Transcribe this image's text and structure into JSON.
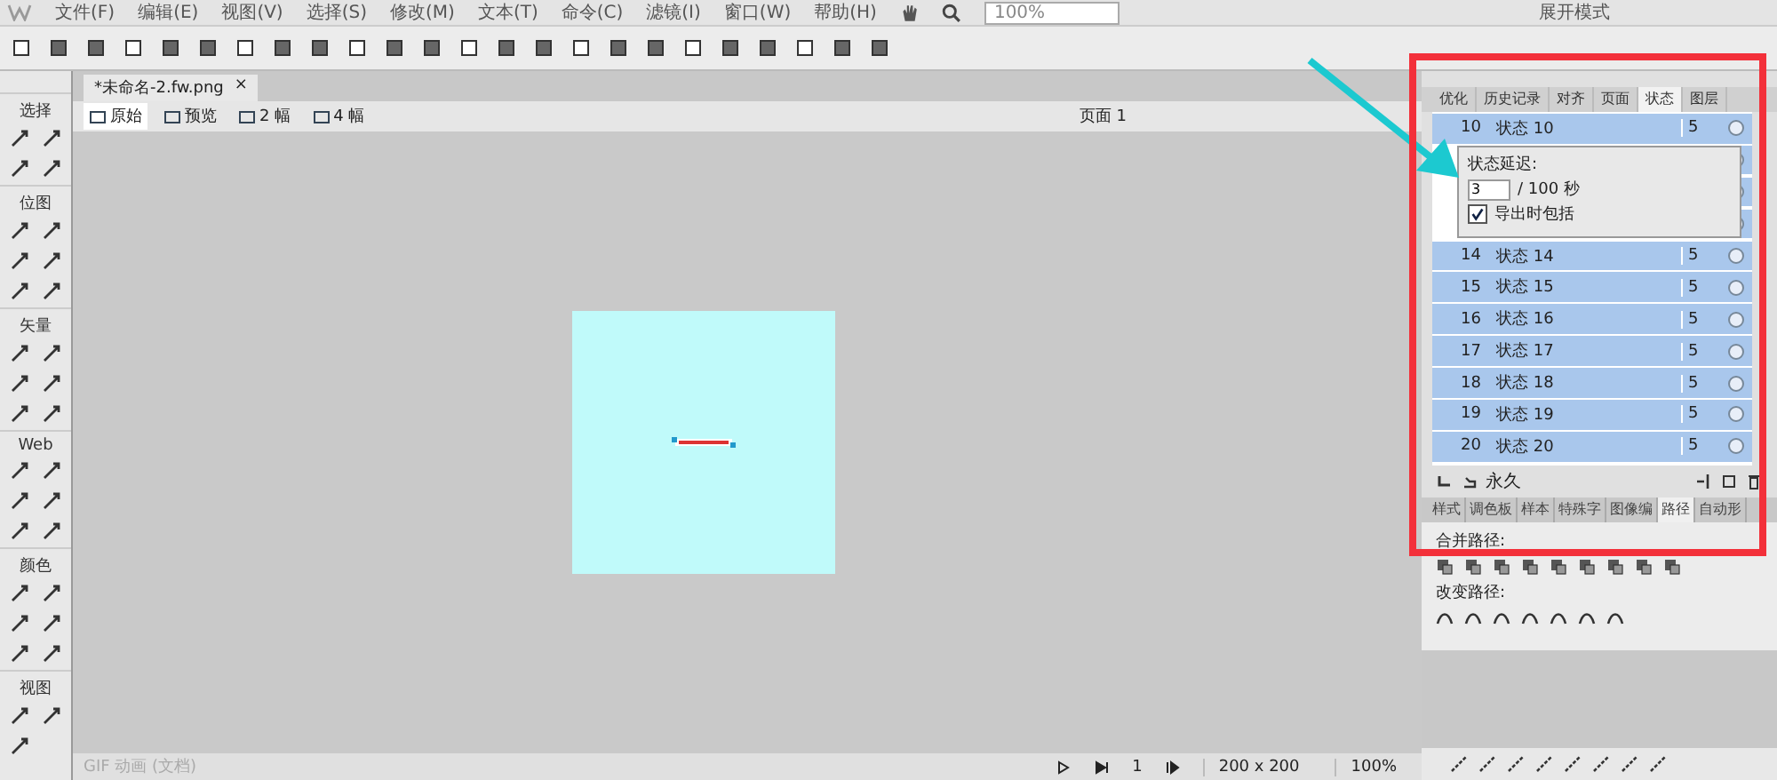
{
  "menu_bar": {
    "items": [
      "文件(F)",
      "编辑(E)",
      "视图(V)",
      "选择(S)",
      "修改(M)",
      "文本(T)",
      "命令(C)",
      "滤镜(I)",
      "窗口(W)",
      "帮助(H)"
    ],
    "zoom": "100%",
    "workspace": "展开模式"
  },
  "tools_panel": {
    "sections": [
      "选择",
      "位图",
      "矢量",
      "Web",
      "颜色",
      "视图"
    ]
  },
  "document_tab": {
    "title": "*未命名-2.fw.png",
    "close": "×"
  },
  "view_modes": [
    {
      "label": "原始",
      "selected": true
    },
    {
      "label": "预览",
      "selected": false
    },
    {
      "label": "2 幅",
      "selected": false
    },
    {
      "label": "4 幅",
      "selected": false
    }
  ],
  "page_selector": "页面 1",
  "status_bar": {
    "format": "GIF 动画 (文档)",
    "frame": "1",
    "size": "200 x 200",
    "zoom": "100%"
  },
  "states_panel": {
    "tabs": [
      {
        "label": "优化",
        "selected": false
      },
      {
        "label": "历史记录",
        "selected": false
      },
      {
        "label": "对齐",
        "selected": false
      },
      {
        "label": "页面",
        "selected": false
      },
      {
        "label": "状态",
        "selected": true
      },
      {
        "label": "图层",
        "selected": false
      }
    ],
    "rows": [
      {
        "kind": "full",
        "number": "10",
        "name": "状态 10",
        "delay": "5"
      },
      {
        "kind": "covered"
      },
      {
        "kind": "covered"
      },
      {
        "kind": "covered"
      },
      {
        "kind": "full",
        "number": "14",
        "name": "状态 14",
        "delay": "5"
      },
      {
        "kind": "full",
        "number": "15",
        "name": "状态 15",
        "delay": "5"
      },
      {
        "kind": "full",
        "number": "16",
        "name": "状态 16",
        "delay": "5"
      },
      {
        "kind": "full",
        "number": "17",
        "name": "状态 17",
        "delay": "5"
      },
      {
        "kind": "full",
        "number": "18",
        "name": "状态 18",
        "delay": "5"
      },
      {
        "kind": "full",
        "number": "19",
        "name": "状态 19",
        "delay": "5"
      },
      {
        "kind": "full",
        "number": "20",
        "name": "状态 20",
        "delay": "5"
      }
    ],
    "delay_popup": {
      "label": "状态延迟:",
      "value": "3",
      "unit": "/ 100 秒",
      "include_on_export": {
        "label": "导出时包括",
        "checked": true
      }
    },
    "loop": "永久"
  },
  "path_panel": {
    "tabs": [
      {
        "label": "样式",
        "selected": false
      },
      {
        "label": "调色板",
        "selected": false
      },
      {
        "label": "样本",
        "selected": false
      },
      {
        "label": "特殊字",
        "selected": false
      },
      {
        "label": "图像编",
        "selected": false
      },
      {
        "label": "路径",
        "selected": true
      },
      {
        "label": "自动形",
        "selected": false
      }
    ],
    "combine_label": "合并路径:",
    "alter_label": "改变路径:"
  }
}
